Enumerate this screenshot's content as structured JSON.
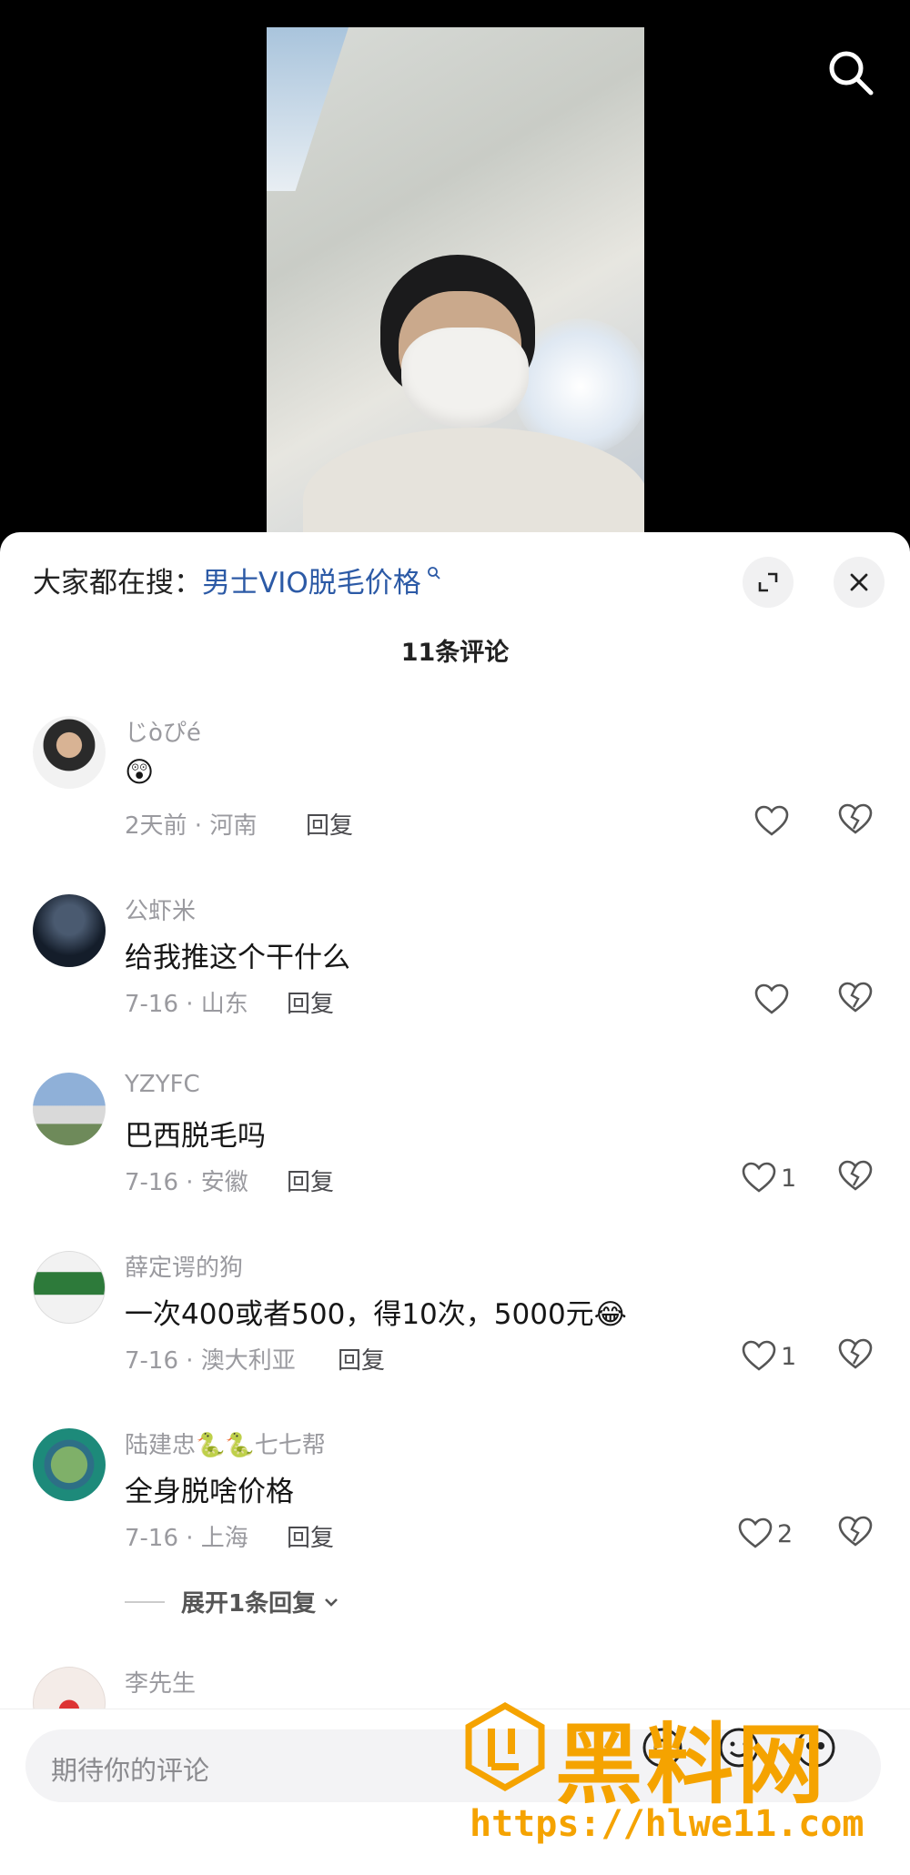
{
  "search_suggest": {
    "prefix": "大家都在搜：",
    "query": "男士VIO脱毛价格"
  },
  "comment_count": "11条评论",
  "comments": [
    {
      "username": "じòぴé",
      "content": "😲",
      "meta": "2天前 · 河南",
      "reply": "回复",
      "likes": ""
    },
    {
      "username": "公虾米",
      "content": "给我推这个干什么",
      "meta": "7-16 · 山东",
      "reply": "回复",
      "likes": ""
    },
    {
      "username": "YZYFC",
      "content": "巴西脱毛吗",
      "meta": "7-16 · 安徽",
      "reply": "回复",
      "likes": "1"
    },
    {
      "username": "薛定谔的狗",
      "content": "一次400或者500，得10次，5000元😂",
      "meta": "7-16 · 澳大利亚",
      "reply": "回复",
      "likes": "1"
    },
    {
      "username": "陆建忠🐍🐍七七帮",
      "content": "全身脱啥价格",
      "meta": "7-16 · 上海",
      "reply": "回复",
      "likes": "2"
    },
    {
      "username": "李先生"
    }
  ],
  "expand_replies": "展开1条回复",
  "input": {
    "placeholder": "期待你的评论"
  },
  "watermark": {
    "text": "黑料网",
    "url": "https://hlwe11.com"
  },
  "colors": {
    "link": "#2c5aa6",
    "watermark": "#f5a300"
  }
}
